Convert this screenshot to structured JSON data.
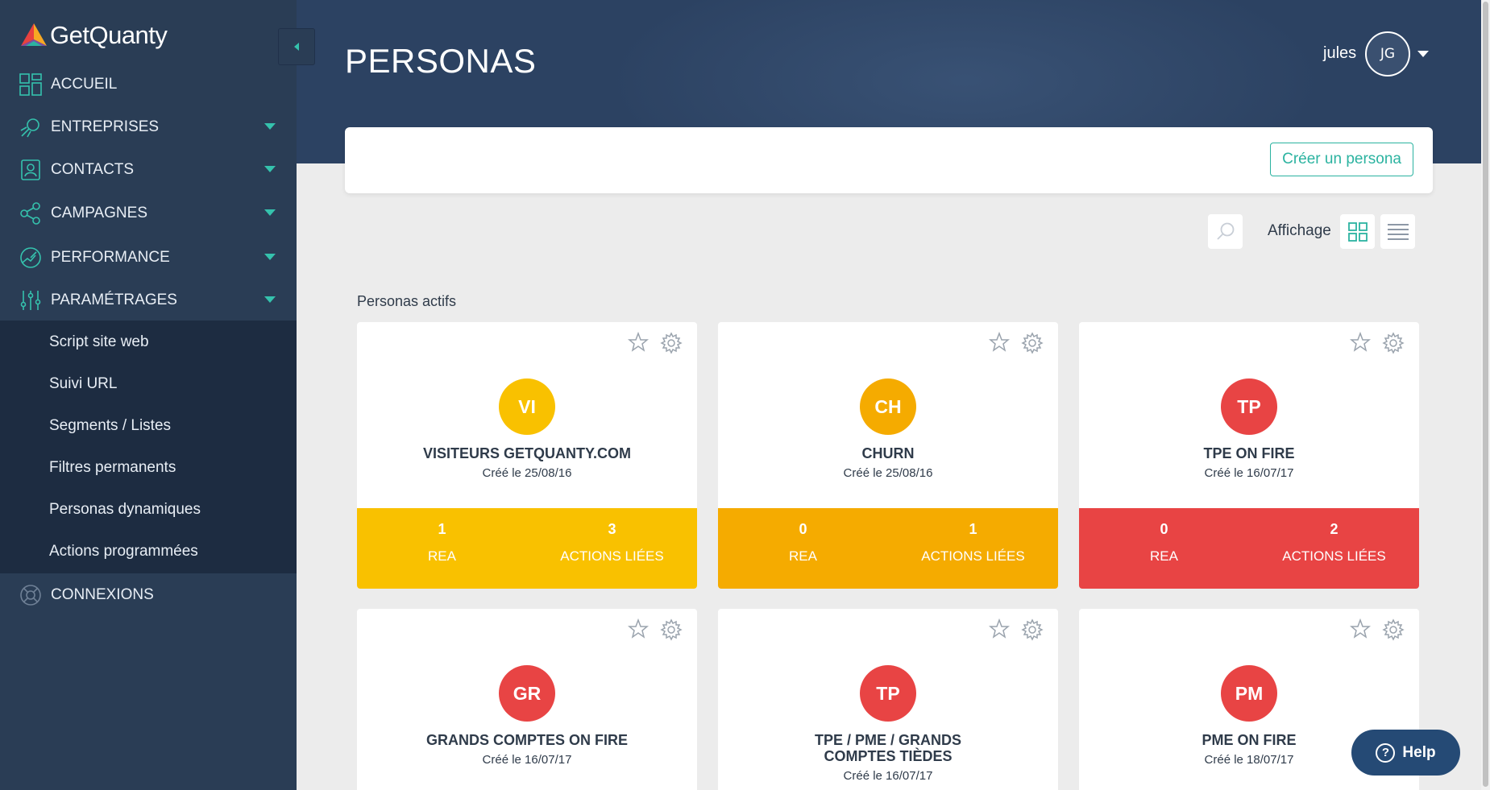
{
  "app": {
    "logo_text": "GetQuanty"
  },
  "sidebar": {
    "items": [
      {
        "label": "ACCUEIL",
        "icon": "dashboard-icon"
      },
      {
        "label": "ENTREPRISES",
        "icon": "rocket-icon"
      },
      {
        "label": "CONTACTS",
        "icon": "contact-card-icon"
      },
      {
        "label": "CAMPAGNES",
        "icon": "share-nodes-icon"
      },
      {
        "label": "PERFORMANCE",
        "icon": "gauge-icon"
      },
      {
        "label": "PARAMÉTRAGES",
        "icon": "sliders-icon"
      },
      {
        "label": "CONNEXIONS",
        "icon": "lifebuoy-icon"
      }
    ],
    "submenu": [
      "Script site web",
      "Suivi URL",
      "Segments / Listes",
      "Filtres permanents",
      "Personas dynamiques",
      "Actions programmées"
    ]
  },
  "header": {
    "title": "PERSONAS",
    "username": "jules",
    "avatar_initials": "JG"
  },
  "toolbar": {
    "create_label": "Créer un persona",
    "view_label": "Affichage"
  },
  "section": {
    "title": "Personas actifs"
  },
  "colors": {
    "yellow": "#f9c100",
    "orange": "#f5ab00",
    "red": "#e84444",
    "teal": "#2bb3a0"
  },
  "personas": [
    {
      "initials": "VI",
      "name": "VISITEURS GETQUANTY.COM",
      "date": "Créé le 25/08/16",
      "rea": "1",
      "rea_label": "REA",
      "actions": "3",
      "actions_label": "ACTIONS LIÉES",
      "color": "#f9c100"
    },
    {
      "initials": "CH",
      "name": "CHURN",
      "date": "Créé le 25/08/16",
      "rea": "0",
      "rea_label": "REA",
      "actions": "1",
      "actions_label": "ACTIONS LIÉES",
      "color": "#f5ab00"
    },
    {
      "initials": "TP",
      "name": "TPE ON FIRE",
      "date": "Créé le 16/07/17",
      "rea": "0",
      "rea_label": "REA",
      "actions": "2",
      "actions_label": "ACTIONS LIÉES",
      "color": "#e84444"
    },
    {
      "initials": "GR",
      "name": "GRANDS COMPTES ON FIRE",
      "date": "Créé le 16/07/17",
      "color": "#e84444"
    },
    {
      "initials": "TP",
      "name_line1": "TPE / PME / GRANDS",
      "name_line2": "COMPTES TIÈDES",
      "date": "Créé le 16/07/17",
      "color": "#e84444"
    },
    {
      "initials": "PM",
      "name": "PME ON FIRE",
      "date": "Créé le 18/07/17",
      "color": "#e84444"
    }
  ],
  "help": {
    "label": "Help"
  }
}
